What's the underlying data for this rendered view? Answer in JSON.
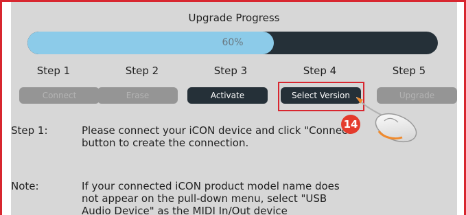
{
  "title": "Upgrade Progress",
  "progress": {
    "value": 0.6,
    "label": "60%"
  },
  "steps": [
    {
      "label": "Step 1",
      "button": "Connect",
      "state": "disabled"
    },
    {
      "label": "Step 2",
      "button": "Erase",
      "state": "disabled"
    },
    {
      "label": "Step 3",
      "button": "Activate",
      "state": "active"
    },
    {
      "label": "Step 4",
      "button": "Select Version",
      "state": "active"
    },
    {
      "label": "Step 5",
      "button": "Upgrade",
      "state": "disabled"
    }
  ],
  "callout": {
    "number": "14"
  },
  "instructions": [
    {
      "label": "Step 1:",
      "text_lines": [
        "Please connect your iCON device and click \"Connect\"",
        "button to create the connection."
      ]
    },
    {
      "label": "Note:",
      "text_lines": [
        "If your connected iCON product model name does",
        "not appear on the pull-down menu, select \"USB",
        "Audio Device\" as the MIDI In/Out device"
      ]
    }
  ],
  "colors": {
    "frame": "#d8262f",
    "panel": "#d7d7d7",
    "track": "#253038",
    "fill": "#8ccbe9",
    "badge": "#e43b2c"
  },
  "icons": {
    "pointer": "mouse-icon"
  }
}
